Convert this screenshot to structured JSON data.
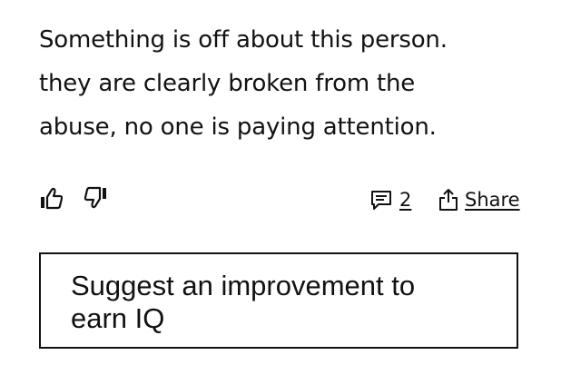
{
  "annotation": {
    "lines": [
      "Something is off about this person.",
      "they are clearly broken from the",
      "abuse, no one is paying attention."
    ]
  },
  "actions": {
    "upvote_icon": "thumbs-up-icon",
    "downvote_icon": "thumbs-down-icon",
    "comment_icon": "comment-icon",
    "comment_count": "2",
    "share_icon": "share-icon",
    "share_label": "Share"
  },
  "suggest": {
    "label": "Suggest an improvement to earn IQ"
  },
  "colors": {
    "text": "#121212",
    "border": "#111111",
    "background": "#ffffff"
  }
}
